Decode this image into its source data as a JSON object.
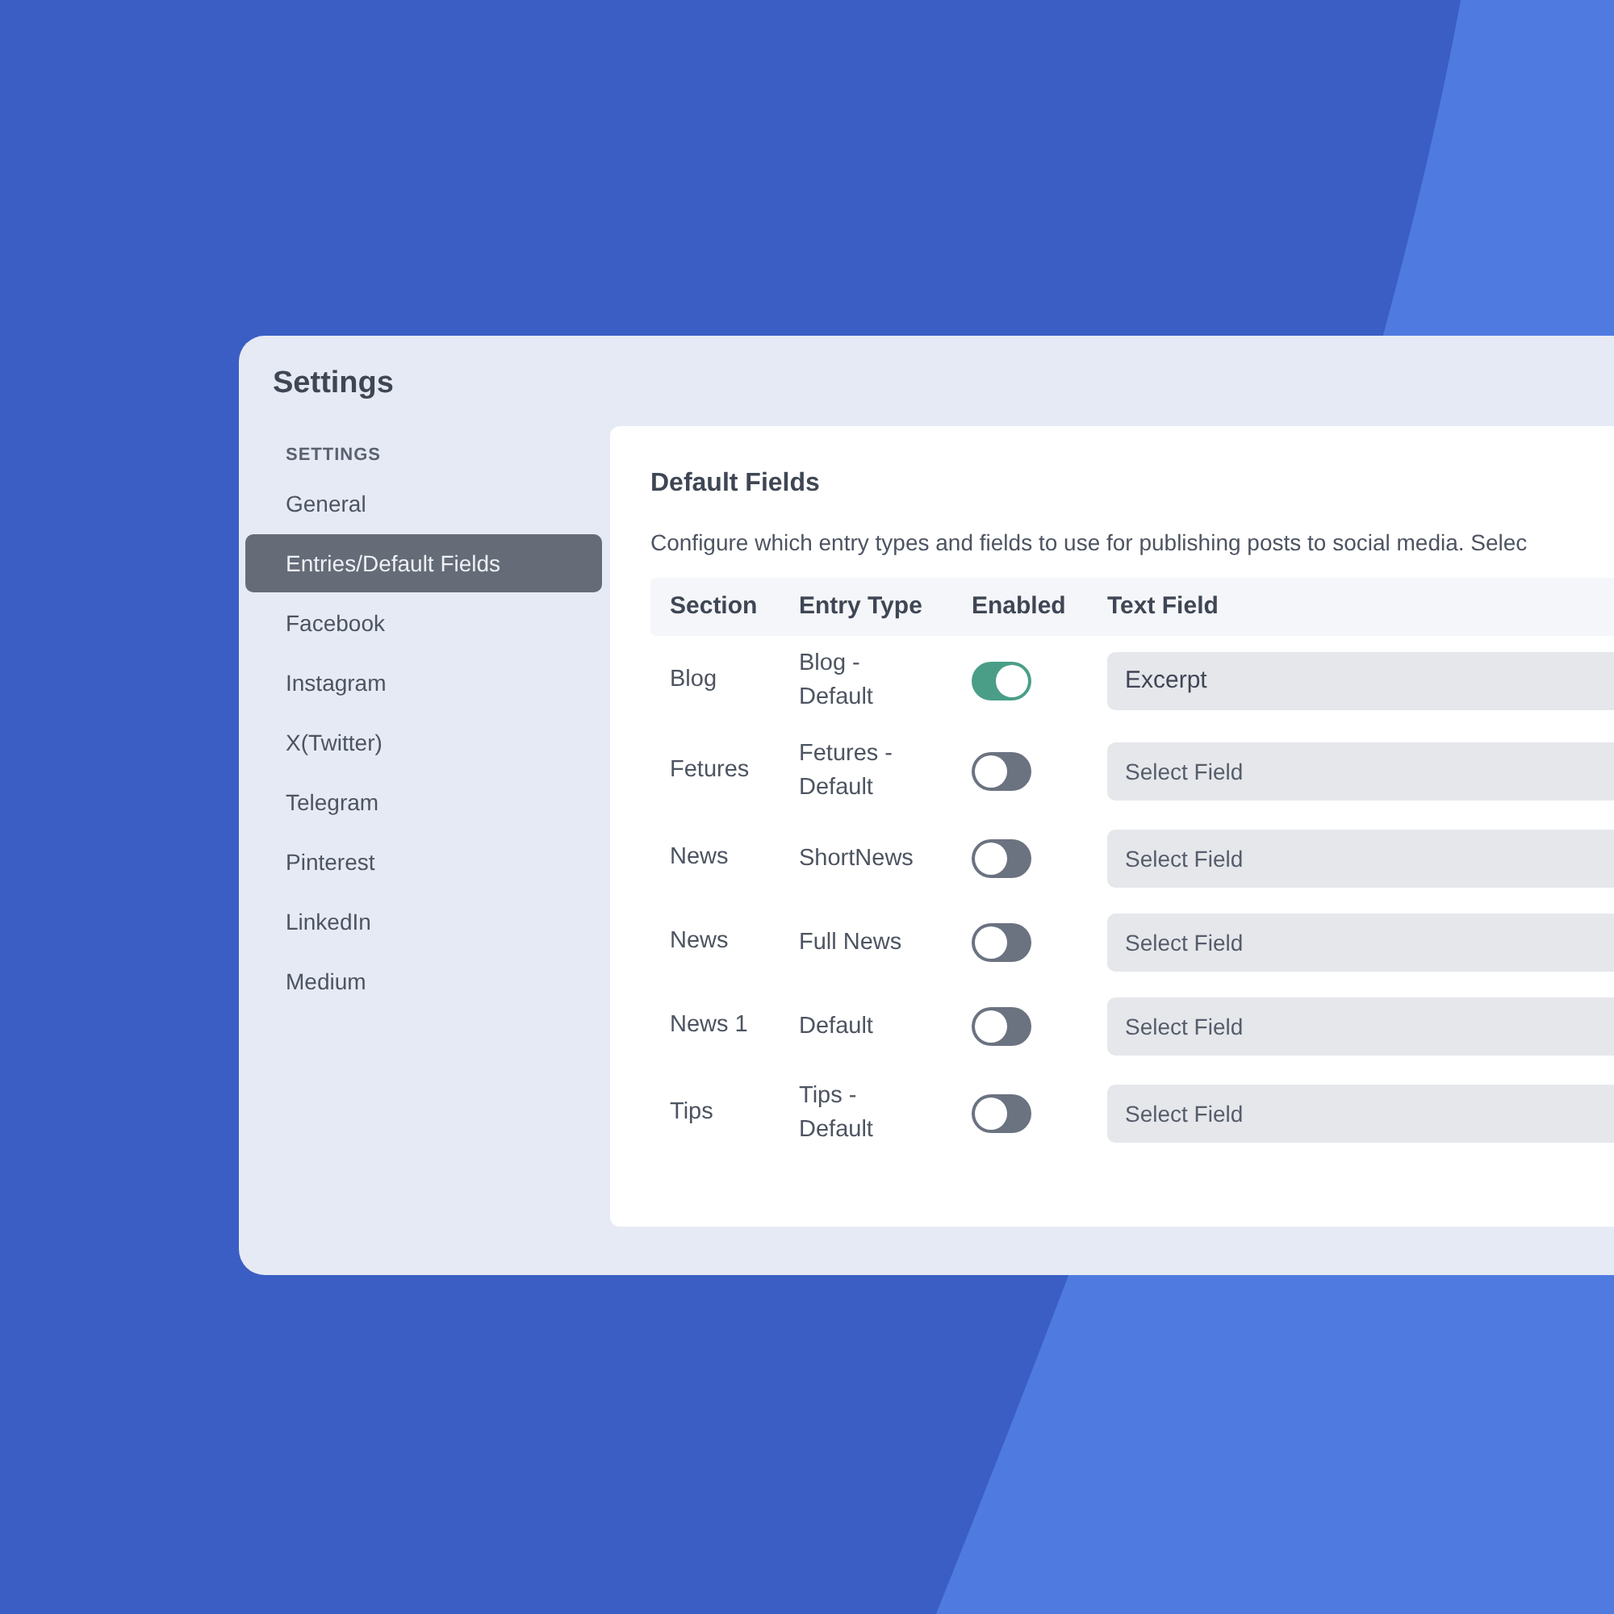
{
  "window": {
    "title": "Settings"
  },
  "sidebar": {
    "heading": "SETTINGS",
    "items": [
      {
        "label": "General",
        "selected": false
      },
      {
        "label": "Entries/Default Fields",
        "selected": true
      },
      {
        "label": "Facebook",
        "selected": false
      },
      {
        "label": "Instagram",
        "selected": false
      },
      {
        "label": "X(Twitter)",
        "selected": false
      },
      {
        "label": "Telegram",
        "selected": false
      },
      {
        "label": "Pinterest",
        "selected": false
      },
      {
        "label": "LinkedIn",
        "selected": false
      },
      {
        "label": "Medium",
        "selected": false
      }
    ]
  },
  "panel": {
    "title": "Default Fields",
    "description": "Configure which entry types and fields to use for publishing posts to social media. Selec"
  },
  "table": {
    "columns": [
      "Section",
      "Entry Type",
      "Enabled",
      "Text Field"
    ],
    "rows": [
      {
        "section": "Blog",
        "entry_type": "Blog -\nDefault",
        "enabled": true,
        "text_field": "Excerpt",
        "placeholder": false
      },
      {
        "section": "Fetures",
        "entry_type": "Fetures -\nDefault",
        "enabled": false,
        "text_field": "Select Field",
        "placeholder": true
      },
      {
        "section": "News",
        "entry_type": "ShortNews",
        "enabled": false,
        "text_field": "Select Field",
        "placeholder": true
      },
      {
        "section": "News",
        "entry_type": "Full News",
        "enabled": false,
        "text_field": "Select Field",
        "placeholder": true
      },
      {
        "section": "News 1",
        "entry_type": "Default",
        "enabled": false,
        "text_field": "Select Field",
        "placeholder": true
      },
      {
        "section": "Tips",
        "entry_type": "Tips -\nDefault",
        "enabled": false,
        "text_field": "Select Field",
        "placeholder": true
      }
    ]
  }
}
